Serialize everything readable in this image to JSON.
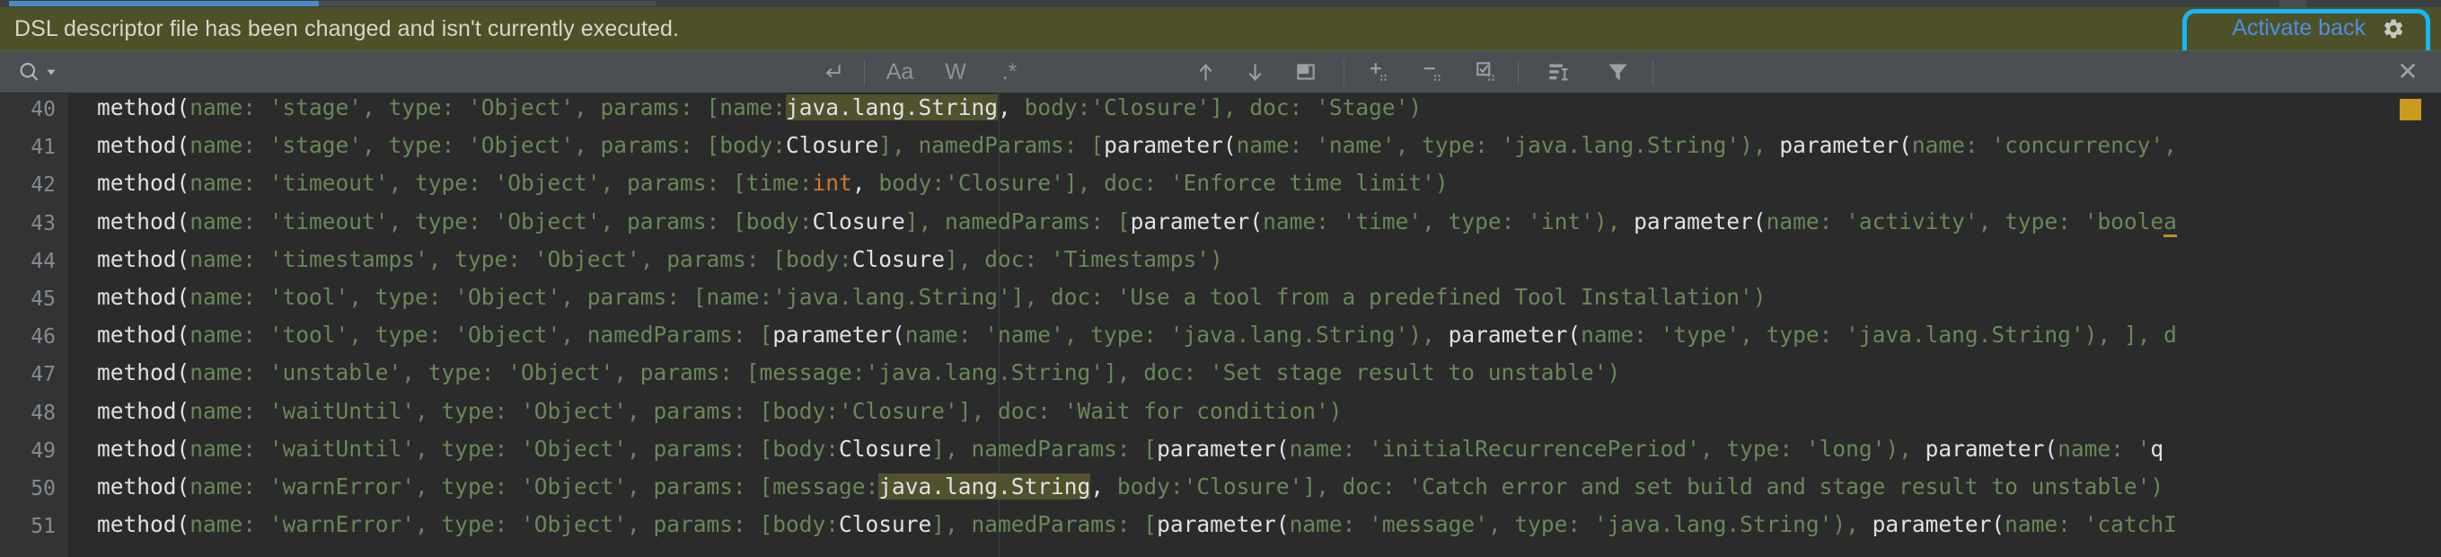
{
  "progress": {
    "percent": 47
  },
  "notification": {
    "message": "DSL descriptor file has been changed and isn't currently executed.",
    "action_label": "Activate back",
    "action_icon": "gear-icon",
    "background": "#4e5128",
    "highlight_color": "#15b7f5",
    "link_color": "#4a90e2"
  },
  "toolbar": {
    "search_icon": "search-icon",
    "search_dropdown_icon": "chevron-down-icon",
    "search_value": "",
    "search_placeholder": "",
    "newline_icon": "new-line-icon",
    "match_case_label": "Aa",
    "words_label": "W",
    "regex_label": ".*",
    "prev_icon": "arrow-up-icon",
    "next_icon": "arrow-down-icon",
    "select_in_editor_icon": "open-in-editor-icon",
    "expand_all_icon": "expand-all-icon",
    "collapse_all_icon": "collapse-all-icon",
    "select_all_icon": "select-all-icon",
    "group_icon": "group-by-icon",
    "filter_icon": "filter-icon",
    "close_icon": "close-icon"
  },
  "editor": {
    "first_line_number": 40,
    "match_highlight_color": "#51512d",
    "stripe_marker_color": "#c99b1e",
    "lines": [
      {
        "n": 40,
        "html": "<span class=\"tok-p\">method(</span><span class=\"tok-g\">name: 'stage', type: 'Object', params: [name:</span><span class=\"tok-hl\">java.lang.String</span><span class=\"tok-p\">, </span><span class=\"tok-g\">body:'Closure'], doc: 'Stage')</span>"
      },
      {
        "n": 41,
        "html": "<span class=\"tok-p\">method(</span><span class=\"tok-g\">name: 'stage', type: 'Object', params: [body:</span><span class=\"tok-p\">Closure</span><span class=\"tok-g\">], namedParams: [</span><span class=\"tok-p\">parameter(</span><span class=\"tok-g\">name: 'name', type: 'java.lang.String'), </span><span class=\"tok-p\">parameter(</span><span class=\"tok-g\">name: 'concurrency',</span>"
      },
      {
        "n": 42,
        "html": "<span class=\"tok-p\">method(</span><span class=\"tok-g\">name: 'timeout', type: 'Object', params: [time:</span><span class=\"tok-kw\">int</span><span class=\"tok-p\">, </span><span class=\"tok-g\">body:'Closure'], doc: 'Enforce time limit')</span>"
      },
      {
        "n": 43,
        "html": "<span class=\"tok-p\">method(</span><span class=\"tok-g\">name: 'timeout', type: 'Object', params: [body:</span><span class=\"tok-p\">Closure</span><span class=\"tok-g\">], namedParams: [</span><span class=\"tok-p\">parameter(</span><span class=\"tok-g\">name: 'time', type: 'int'), </span><span class=\"tok-p\">parameter(</span><span class=\"tok-g\">name: 'activity', type: 'boole</span><span class=\"tok-g tok-err\">a</span>"
      },
      {
        "n": 44,
        "html": "<span class=\"tok-p\">method(</span><span class=\"tok-g\">name: 'timestamps', type: 'Object', params: [body:</span><span class=\"tok-p\">Closure</span><span class=\"tok-g\">], doc: 'Timestamps')</span>"
      },
      {
        "n": 45,
        "html": "<span class=\"tok-p\">method(</span><span class=\"tok-g\">name: 'tool', type: 'Object', params: [name:'java.lang.String'], doc: 'Use a tool from a predefined Tool Installation')</span>"
      },
      {
        "n": 46,
        "html": "<span class=\"tok-p\">method(</span><span class=\"tok-g\">name: 'tool', type: 'Object', namedParams: [</span><span class=\"tok-p\">parameter(</span><span class=\"tok-g\">name: 'name', type: 'java.lang.String'), </span><span class=\"tok-p\">parameter(</span><span class=\"tok-g\">name: 'type', type: 'java.lang.String'), ], d</span>"
      },
      {
        "n": 47,
        "html": "<span class=\"tok-p\">method(</span><span class=\"tok-g\">name: 'unstable', type: 'Object', params: [message:'java.lang.String'], doc: 'Set stage result to unstable')</span>"
      },
      {
        "n": 48,
        "html": "<span class=\"tok-p\">method(</span><span class=\"tok-g\">name: 'waitUntil', type: 'Object', params: [body:'Closure'], doc: 'Wait for condition')</span>"
      },
      {
        "n": 49,
        "html": "<span class=\"tok-p\">method(</span><span class=\"tok-g\">name: 'waitUntil', type: 'Object', params: [body:</span><span class=\"tok-p\">Closure</span><span class=\"tok-g\">], namedParams: [</span><span class=\"tok-p\">parameter(</span><span class=\"tok-g\">name: 'initialRecurrencePeriod', type: 'long'), </span><span class=\"tok-p\">parameter(</span><span class=\"tok-g\">name: '</span><span class=\"tok-p\">q</span>"
      },
      {
        "n": 50,
        "html": "<span class=\"tok-p\">method(</span><span class=\"tok-g\">name: 'warnError', type: 'Object', params: [message:</span><span class=\"tok-hl\">java.lang.String</span><span class=\"tok-p\">, </span><span class=\"tok-g\">body:'Closure'], doc: 'Catch error and set build and stage result to unstable')</span>"
      },
      {
        "n": 51,
        "html": "<span class=\"tok-p\">method(</span><span class=\"tok-g\">name: 'warnError', type: 'Object', params: [body:</span><span class=\"tok-p\">Closure</span><span class=\"tok-g\">], namedParams: [</span><span class=\"tok-p\">parameter(</span><span class=\"tok-g\">name: 'message', type: 'java.lang.String'), </span><span class=\"tok-p\">parameter(</span><span class=\"tok-g\">name: 'catchI</span>"
      }
    ]
  }
}
